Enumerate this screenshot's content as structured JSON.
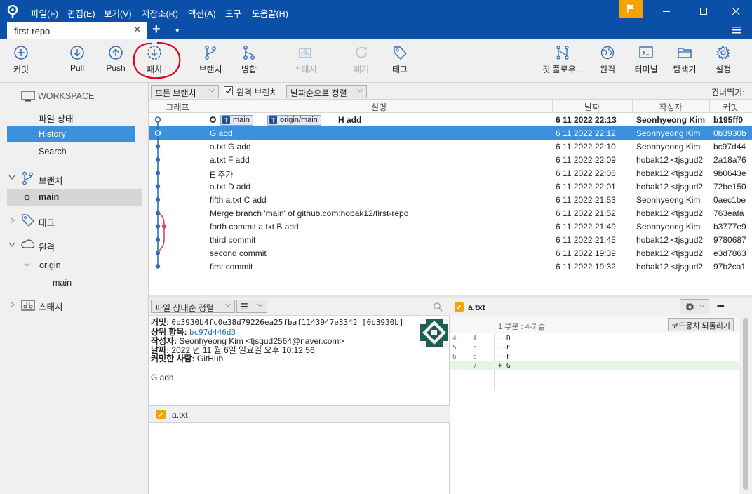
{
  "menu": [
    "파일(F)",
    "편집(E)",
    "보기(V)",
    "저장소(R)",
    "액션(A)",
    "도구",
    "도움말(H)"
  ],
  "tab": {
    "title": "first-repo",
    "close": "×",
    "add": "+",
    "dropdown": "▾"
  },
  "toolbar": {
    "commit": "커밋",
    "pull": "Pull",
    "push": "Push",
    "patch": "패치",
    "branch": "브랜치",
    "merge": "병합",
    "stash": "스태시",
    "discard": "폐기",
    "tag": "태그",
    "gitflow": "깃 플로우...",
    "remote": "원격",
    "terminal": "터미널",
    "explorer": "탐색기",
    "settings": "설정"
  },
  "sidebar": {
    "workspace": "WORKSPACE",
    "file_status": "파일 상태",
    "history": "History",
    "search": "Search",
    "branches": "브랜치",
    "branch_main": "main",
    "tags": "태그",
    "remotes": "원격",
    "origin": "origin",
    "origin_main": "main",
    "stashes": "스태시"
  },
  "filter": {
    "branches": "모든 브랜치",
    "remote_branches": "원격 브랜치",
    "remote_checked": true,
    "sort": "날짜순으로 정렬",
    "jump": "건너뛰기:"
  },
  "columns": {
    "graph": "그래프",
    "desc": "설명",
    "date": "날짜",
    "author": "작성자",
    "commit": "커밋"
  },
  "commits": [
    {
      "desc": "H add",
      "date": "6 11 2022 22:13",
      "author": "Seonhyeong Kim",
      "hash": "b195ff0",
      "labels": [
        "main",
        "origin/main"
      ],
      "bold": true
    },
    {
      "desc": "G add",
      "date": "6 11 2022 22:12",
      "author": "Seonhyeong Kim",
      "hash": "0b3930b",
      "selected": true
    },
    {
      "desc": "a.txt G add",
      "date": "6 11 2022 22:10",
      "author": "Seonhyeong Kim",
      "hash": "bc97d44"
    },
    {
      "desc": "a.txt F add",
      "date": "6 11 2022 22:09",
      "author": "hobak12 <tjsgud2",
      "hash": "2a18a76"
    },
    {
      "desc": "E 추가",
      "date": "6 11 2022 22:06",
      "author": "hobak12 <tjsgud2",
      "hash": "9b0643e"
    },
    {
      "desc": "a.txt D add",
      "date": "6 11 2022 22:01",
      "author": "hobak12 <tjsgud2",
      "hash": "72be150"
    },
    {
      "desc": "fifth a.txt C add",
      "date": "6 11 2022 21:53",
      "author": "Seonhyeong Kim",
      "hash": "0aec1be"
    },
    {
      "desc": "Merge branch 'main' of github.com:hobak12/first-repo",
      "date": "6 11 2022 21:52",
      "author": "hobak12 <tjsgud2",
      "hash": "763eafa"
    },
    {
      "desc": "forth commit a.txt B add",
      "date": "6 11 2022 21:49",
      "author": "Seonhyeong Kim",
      "hash": "b3777e9"
    },
    {
      "desc": "third commit",
      "date": "6 11 2022 21:45",
      "author": "hobak12 <tjsgud2",
      "hash": "9780687"
    },
    {
      "desc": "second commit",
      "date": "6 11 2022 19:39",
      "author": "hobak12 <tjsgud2",
      "hash": "e3d7863"
    },
    {
      "desc": "first commit",
      "date": "6 11 2022 19:32",
      "author": "hobak12 <tjsgud2",
      "hash": "97b2ca1"
    }
  ],
  "lower": {
    "sort_files": "파일 상태순 정렬",
    "view_mode": "☰",
    "info": {
      "commit_key": "커밋:",
      "commit_val": "0b3930b4fc0e38d79226ea25fbaf1143947e3342 [0b3930b]",
      "parent_key": "상위 항목:",
      "parent_val": "bc97d446d3",
      "author_key": "작성자:",
      "author_val": "Seonhyeong Kim <tjsgud2564@naver.com>",
      "date_key": "날짜:",
      "date_val": "2022 년 11 월 6일 일요일 오후 10:12:56",
      "committer_key": "커밋한 사람:",
      "committer_val": "GitHub",
      "message": "G add"
    },
    "file": "a.txt"
  },
  "diff": {
    "file": "a.txt",
    "hunk": "1 부분 : 4-7 줄",
    "reverse_hunk": "코드뭉치 되돌리기",
    "more": "•••",
    "lines": [
      {
        "old": "4",
        "new": "4",
        "sign": "",
        "text": "D",
        "type": "ctx"
      },
      {
        "old": "5",
        "new": "5",
        "sign": "",
        "text": "E",
        "type": "ctx"
      },
      {
        "old": "6",
        "new": "6",
        "sign": "",
        "text": "F",
        "type": "ctx"
      },
      {
        "old": "",
        "new": "7",
        "sign": "+",
        "text": "G",
        "type": "add"
      }
    ]
  },
  "colors": {
    "titlebar": "#0a50a8",
    "selection": "#3b91dd",
    "graph": "#2f6db5",
    "graph_branch": "#e0435a",
    "annotation": "#e3001b",
    "flag": "#f5a300"
  }
}
